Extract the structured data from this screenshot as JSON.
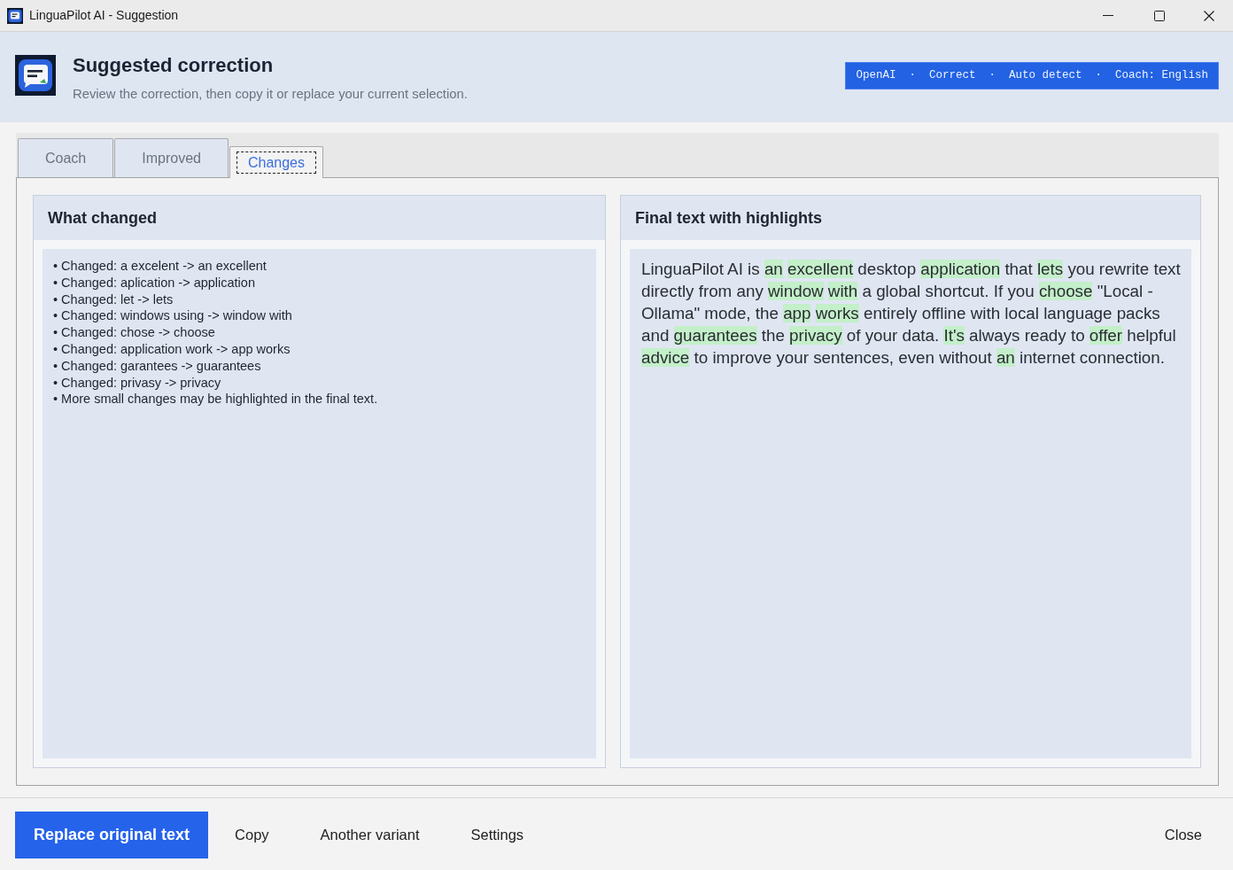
{
  "window": {
    "title": "LinguaPilot AI - Suggestion"
  },
  "header": {
    "title": "Suggested correction",
    "subtitle": "Review the correction, then copy it or replace your current selection.",
    "badge": "OpenAI  ·  Correct  ·  Auto detect  ·  Coach: English"
  },
  "tabs": [
    {
      "label": "Coach",
      "selected": false,
      "focused": false
    },
    {
      "label": "Improved",
      "selected": false,
      "focused": false
    },
    {
      "label": "Changes",
      "selected": true,
      "focused": true
    }
  ],
  "changes_panel": {
    "title": "What changed",
    "items": [
      "• Changed: a excelent -> an excellent",
      "• Changed: aplication -> application",
      "• Changed: let -> lets",
      "• Changed: windows using -> window with",
      "• Changed: chose -> choose",
      "• Changed: application work -> app works",
      "• Changed: garantees -> guarantees",
      "• Changed: privasy -> privacy",
      "• More small changes may be highlighted in the final text."
    ]
  },
  "final_panel": {
    "title": "Final text with highlights",
    "segments": [
      {
        "text": "LinguaPilot AI is",
        "highlighted": false
      },
      {
        "text": "an",
        "highlighted": true
      },
      {
        "text": "excellent",
        "highlighted": true
      },
      {
        "text": "desktop",
        "highlighted": false
      },
      {
        "text": "application",
        "highlighted": true
      },
      {
        "text": "that",
        "highlighted": false
      },
      {
        "text": "lets",
        "highlighted": true
      },
      {
        "text": "you rewrite text directly from any",
        "highlighted": false
      },
      {
        "text": "window",
        "highlighted": true
      },
      {
        "text": "with",
        "highlighted": true
      },
      {
        "text": "a global shortcut. If you",
        "highlighted": false
      },
      {
        "text": "choose",
        "highlighted": true
      },
      {
        "text": "\"Local - Ollama\" mode, the",
        "highlighted": false
      },
      {
        "text": "app",
        "highlighted": true
      },
      {
        "text": "works",
        "highlighted": true
      },
      {
        "text": "entirely offline with local language packs and",
        "highlighted": false
      },
      {
        "text": "guarantees",
        "highlighted": true
      },
      {
        "text": "the",
        "highlighted": false
      },
      {
        "text": "privacy",
        "highlighted": true
      },
      {
        "text": "of your data.",
        "highlighted": false
      },
      {
        "text": "It's",
        "highlighted": true
      },
      {
        "text": "always ready to",
        "highlighted": false
      },
      {
        "text": "offer",
        "highlighted": true
      },
      {
        "text": "helpful",
        "highlighted": false
      },
      {
        "text": "advice",
        "highlighted": true
      },
      {
        "text": "to improve your sentences, even without",
        "highlighted": false
      },
      {
        "text": "an",
        "highlighted": true
      },
      {
        "text": "internet connection.",
        "highlighted": false
      }
    ]
  },
  "footer": {
    "buttons": [
      {
        "label": "Replace original text",
        "kind": "primary"
      },
      {
        "label": "Copy",
        "kind": "flat"
      },
      {
        "label": "Another variant",
        "kind": "flat"
      },
      {
        "label": "Settings",
        "kind": "flat"
      }
    ],
    "close": "Close"
  }
}
